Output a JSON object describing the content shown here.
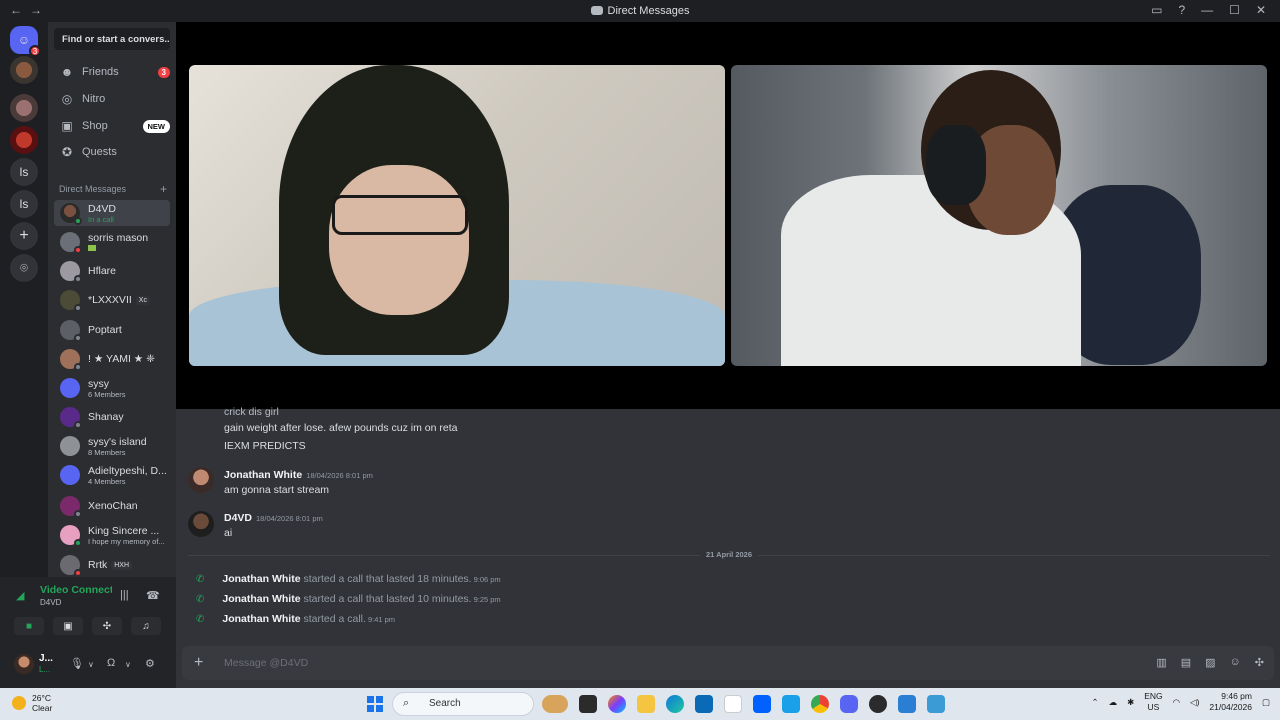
{
  "window": {
    "title": "Direct Messages"
  },
  "servers": [
    {
      "label": "",
      "type": "home",
      "badge": "3"
    },
    {
      "label": "",
      "type": "avatar"
    },
    {
      "label": "",
      "type": "avatar"
    },
    {
      "label": "",
      "type": "avatar"
    },
    {
      "label": "ls",
      "type": "text"
    },
    {
      "label": "ls",
      "type": "text"
    },
    {
      "label": "+",
      "type": "add"
    },
    {
      "label": "⌾",
      "type": "explore"
    }
  ],
  "sidebar": {
    "search_placeholder": "Find or start a convers...",
    "nav": [
      {
        "label": "Friends",
        "badge": "3"
      },
      {
        "label": "Nitro"
      },
      {
        "label": "Shop",
        "tag": "NEW"
      },
      {
        "label": "Quests"
      }
    ],
    "dm_header": "Direct Messages",
    "dms": [
      {
        "name": "D4VD",
        "sub": "In a call"
      },
      {
        "name": "sorris mason",
        "sub": ""
      },
      {
        "name": "Hflare",
        "sub": ""
      },
      {
        "name": "*LXXXVII",
        "sub": "",
        "tag": "Xc"
      },
      {
        "name": "Poptart",
        "sub": ""
      },
      {
        "name": "! ★ YAMI ★ ❈",
        "sub": ""
      },
      {
        "name": "sysy",
        "sub": "6 Members"
      },
      {
        "name": "Shanay",
        "sub": ""
      },
      {
        "name": "sysy's island",
        "sub": "8 Members"
      },
      {
        "name": "Adieltypeshi, D...",
        "sub": "4 Members"
      },
      {
        "name": "XenoChan",
        "sub": ""
      },
      {
        "name": "King Sincere ...",
        "sub": "I hope my memory of..."
      },
      {
        "name": "Rrtk",
        "sub": "",
        "tag": "HXH"
      }
    ]
  },
  "voice": {
    "title": "Video Connected",
    "channel": "D4VD"
  },
  "user": {
    "name": "J...",
    "status": "L..."
  },
  "messages": {
    "lines_top": [
      "crick dis girl",
      "gain weight after lose. afew pounds cuz im on reta",
      "IEXM PREDICTS"
    ],
    "msg1": {
      "author": "Jonathan White",
      "time": "18/04/2026 8:01 pm",
      "text": "am gonna start stream"
    },
    "msg2": {
      "author": "D4VD",
      "time": "18/04/2026 8:01 pm",
      "text": "ai"
    },
    "divider": "21 April 2026",
    "calls": [
      {
        "author": "Jonathan White",
        "text": "started a call that lasted 18 minutes.",
        "time": "9:06 pm"
      },
      {
        "author": "Jonathan White",
        "text": "started a call that lasted 10 minutes.",
        "time": "9:25 pm"
      },
      {
        "author": "Jonathan White",
        "text": "started a call.",
        "time": "9:41 pm"
      }
    ]
  },
  "composer": {
    "placeholder": "Message @D4VD"
  },
  "taskbar": {
    "weather_temp": "26°C",
    "weather_desc": "Clear",
    "search": "Search",
    "lang1": "ENG",
    "lang2": "US",
    "time": "9:46 pm",
    "date": "21/04/2026"
  },
  "colors": {
    "accent": "#5865f2",
    "online": "#23a55a",
    "danger": "#f23f43"
  }
}
